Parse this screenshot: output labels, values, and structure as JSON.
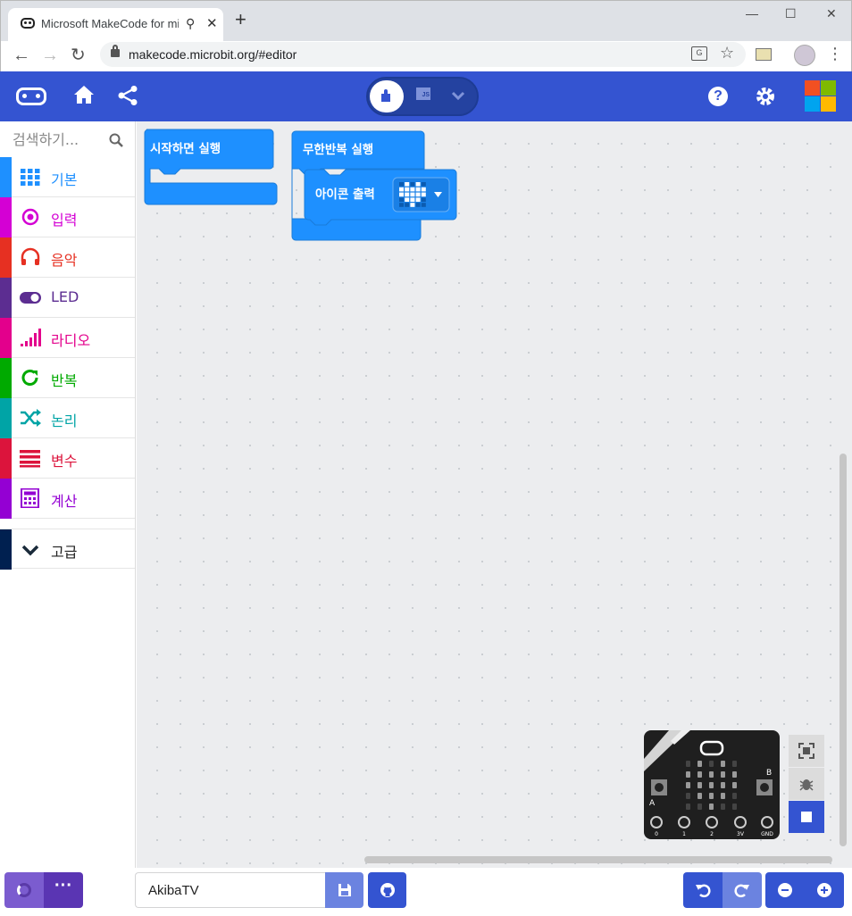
{
  "browser": {
    "tab_title": "Microsoft MakeCode for micro:bit",
    "new_tab_label": "+",
    "url": "makecode.microbit.org/#editor",
    "window_buttons": [
      "—",
      "☐",
      "✕"
    ]
  },
  "header": {
    "editor_modes": [
      "Blocks",
      "JS"
    ],
    "js_label": "JS",
    "help_label": "?"
  },
  "toolbox": {
    "search_placeholder": "검색하기...",
    "categories": [
      {
        "label": "기본",
        "color": "#1e90ff",
        "icon": "grid-icon"
      },
      {
        "label": "입력",
        "color": "#d400d4",
        "icon": "target-icon"
      },
      {
        "label": "음악",
        "color": "#e63022",
        "icon": "headphones-icon"
      },
      {
        "label": "LED",
        "color": "#5c2d91",
        "icon": "toggle-icon"
      },
      {
        "label": "라디오",
        "color": "#e3008c",
        "icon": "signal-icon"
      },
      {
        "label": "반복",
        "color": "#00aa00",
        "icon": "refresh-icon"
      },
      {
        "label": "논리",
        "color": "#00a4a6",
        "icon": "shuffle-icon"
      },
      {
        "label": "변수",
        "color": "#dc143c",
        "icon": "lines-icon"
      },
      {
        "label": "계산",
        "color": "#9400d3",
        "icon": "calculator-icon"
      },
      {
        "label": "고급",
        "color": "#002050",
        "icon": "chevron-down-icon"
      }
    ]
  },
  "workspace": {
    "on_start_label": "시작하면 실행",
    "forever_label": "무한반복 실행",
    "show_icon_label": "아이콘 출력",
    "icon_value": "heart",
    "board_pins": [
      "0",
      "1",
      "2",
      "3V",
      "GND"
    ]
  },
  "bottom": {
    "more_label": "···",
    "project_name": "AkibaTV"
  },
  "colors": {
    "accent": "#3454d1",
    "block_blue": "#1e90ff",
    "workspace_bg": "#ecedef"
  }
}
